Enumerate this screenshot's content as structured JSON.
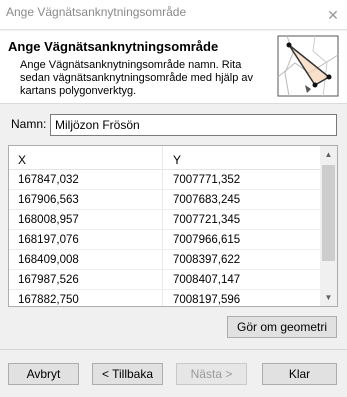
{
  "window": {
    "title": "Ange Vägnätsanknytningsområde"
  },
  "header": {
    "title": "Ange Vägnätsanknytningsområde",
    "description": "Ange Vägnätsanknytningsområde namn. Rita sedan vägnätsanknytningsområde med hjälp av kartans polygonverktyg.",
    "illustration_icon": "map-polygon-icon"
  },
  "form": {
    "name_label": "Namn:",
    "name_value": "Miljözon Frösön"
  },
  "grid": {
    "columns": [
      "X",
      "Y"
    ],
    "rows": [
      [
        "167847,032",
        "7007771,352"
      ],
      [
        "167906,563",
        "7007683,245"
      ],
      [
        "168008,957",
        "7007721,345"
      ],
      [
        "168197,076",
        "7007966,615"
      ],
      [
        "168409,008",
        "7008397,622"
      ],
      [
        "167987,526",
        "7008407,147"
      ],
      [
        "167882,750",
        "7008197,596"
      ]
    ]
  },
  "buttons": {
    "redo_geometry": "Gör om geometri",
    "cancel": "Avbryt",
    "back": "< Tillbaka",
    "next": "Nästa >",
    "finish": "Klar"
  }
}
